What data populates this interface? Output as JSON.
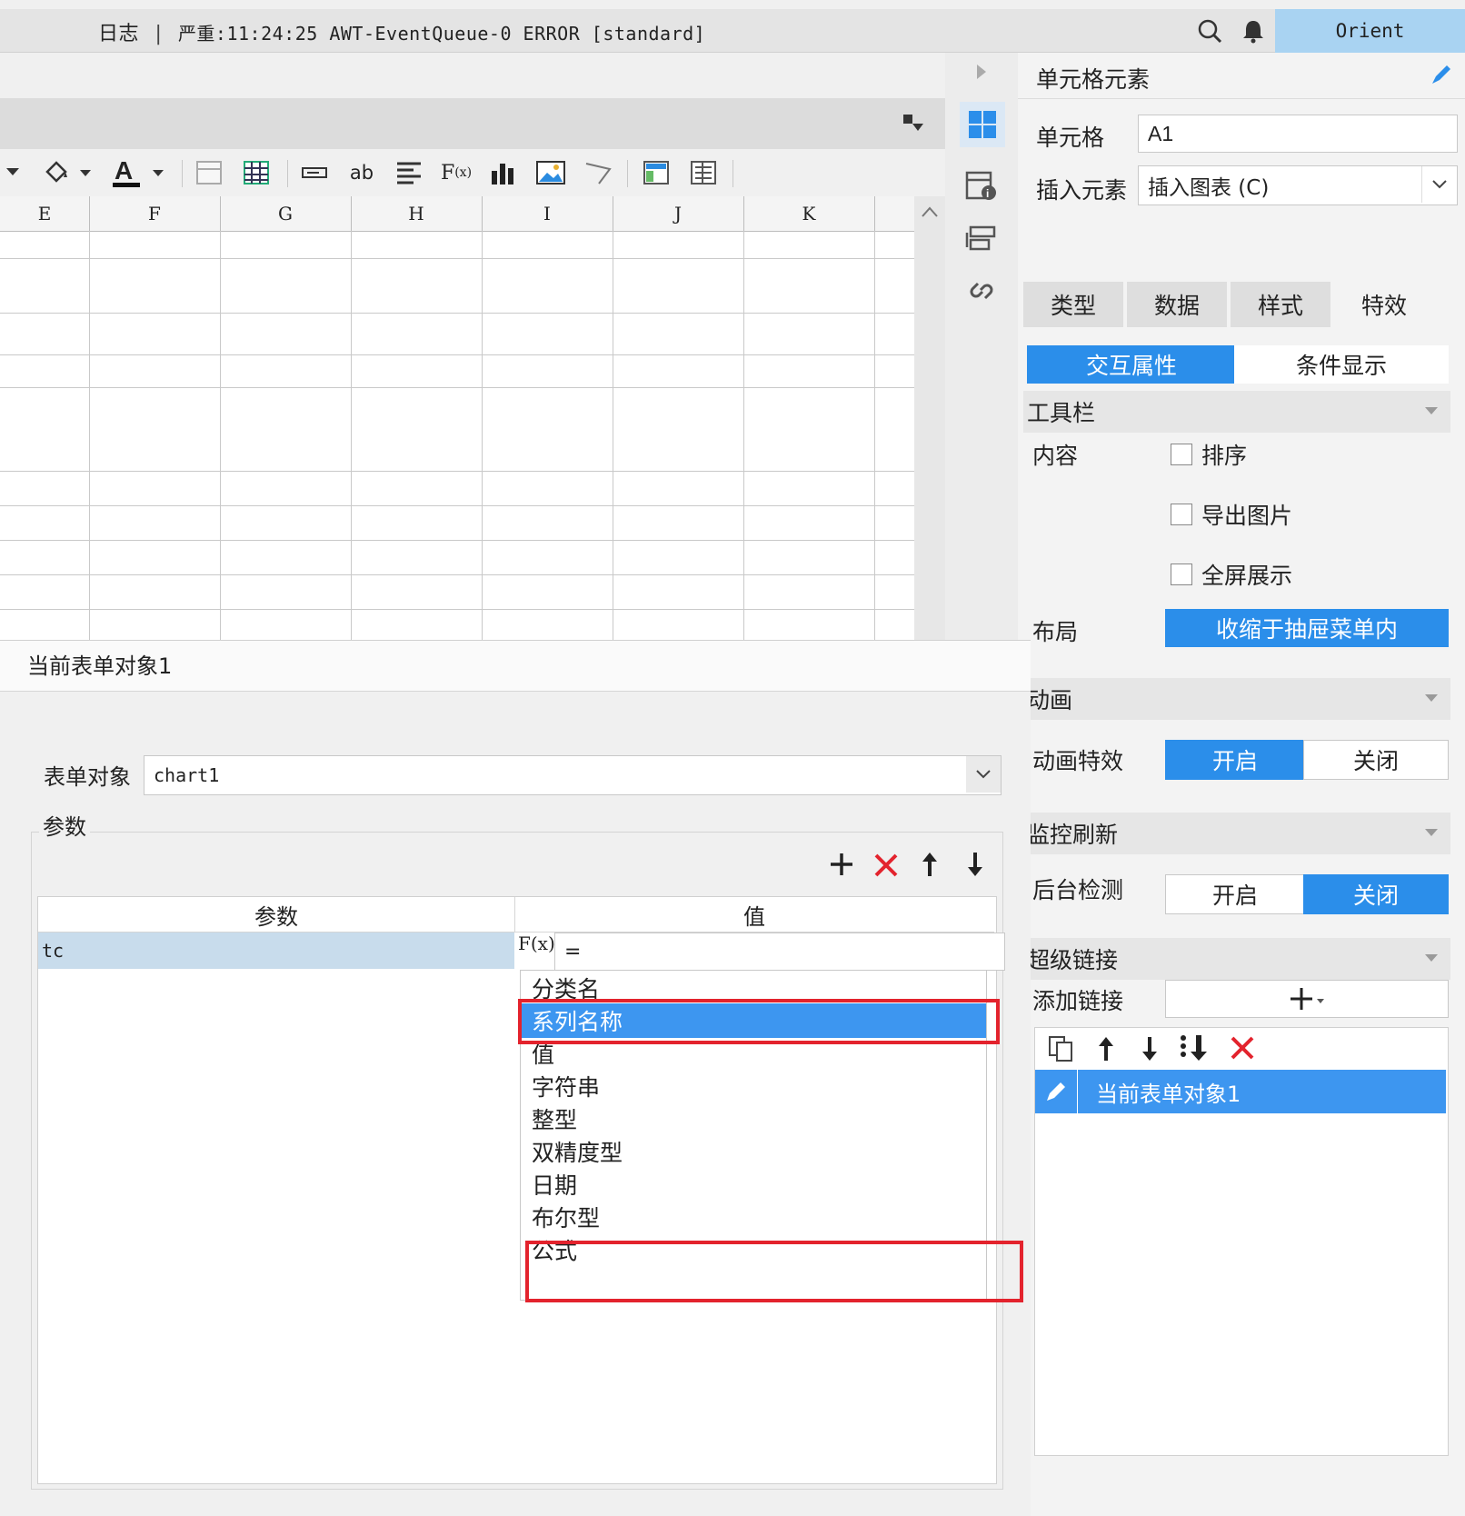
{
  "topbar": {
    "log_label": "日志",
    "log_message": "严重:11:24:25 AWT-EventQueue-0 ERROR [standard]",
    "user_name": "Orient"
  },
  "sheet": {
    "columns": [
      "E",
      "F",
      "G",
      "H",
      "I",
      "J",
      "K"
    ]
  },
  "right_panel": {
    "title": "单元格元素",
    "cell_label": "单元格",
    "cell_value": "A1",
    "insert_label": "插入元素",
    "insert_value": "插入图表 (C)",
    "tabs": [
      "类型",
      "数据",
      "样式",
      "特效"
    ],
    "subtabs": {
      "active": "交互属性",
      "other": "条件显示"
    },
    "toolbar_section": "工具栏",
    "content_label": "内容",
    "checkboxes": [
      "排序",
      "导出图片",
      "全屏展示"
    ],
    "layout_label": "布局",
    "layout_value": "收缩于抽屉菜单内",
    "animation_section": "动画",
    "animation_effect_label": "动画特效",
    "animation_on": "开启",
    "animation_off": "关闭",
    "monitor_section": "监控刷新",
    "backend_label": "后台检测",
    "backend_on": "开启",
    "backend_off": "关闭",
    "hyperlink_section": "超级链接",
    "add_link_label": "添加链接",
    "link_item": "当前表单对象1"
  },
  "dialog": {
    "title": "当前表单对象1",
    "form_object_label": "表单对象",
    "form_object_value": "chart1",
    "params_group_label": "参数",
    "col_param": "参数",
    "col_value": "值",
    "row_param": "tc",
    "row_value": "=",
    "fx_label": "F(x)",
    "dropdown_items": [
      "分类名",
      "系列名称",
      "值",
      "字符串",
      "整型",
      "双精度型",
      "日期",
      "布尔型",
      "公式"
    ],
    "selected_item": "系列名称"
  },
  "colors": {
    "accent": "#2b8eea",
    "highlight_box": "#e3232d",
    "user_bg": "#a9d3f2"
  }
}
